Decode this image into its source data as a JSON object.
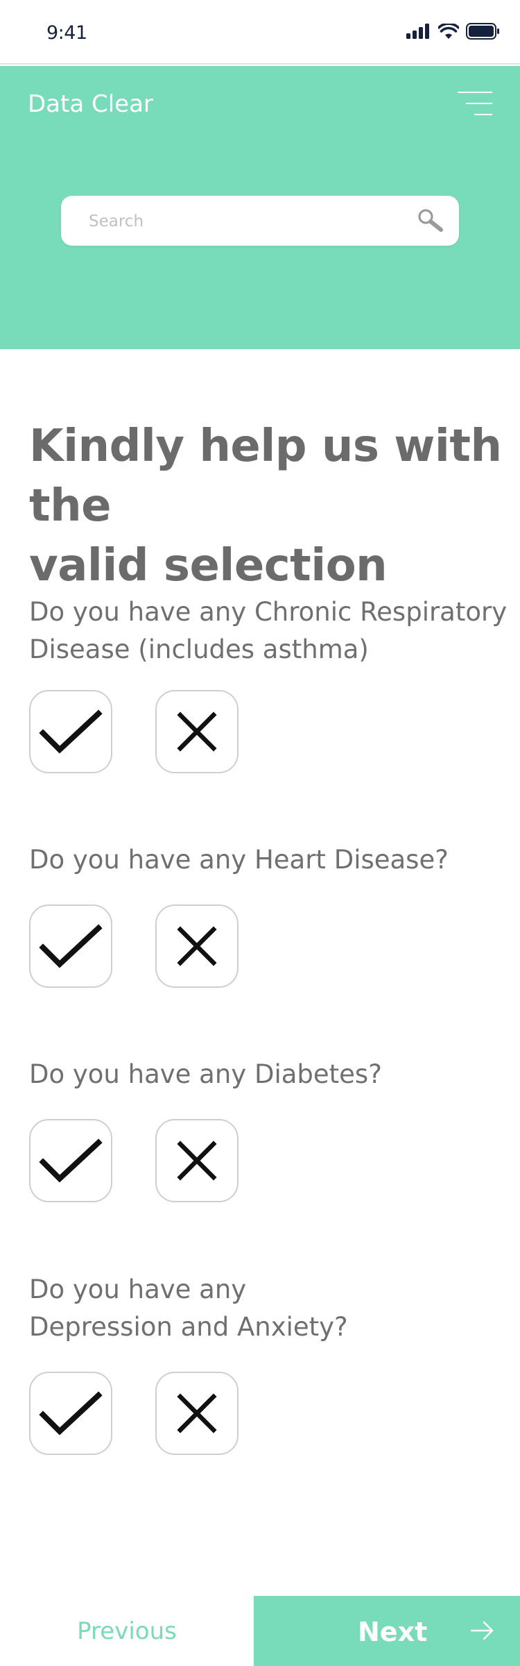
{
  "status_bar": {
    "time": "9:41"
  },
  "header": {
    "app_title": "Data Clear",
    "background_color": "#78dbb9",
    "menu_icon": "hamburger-menu-icon"
  },
  "search": {
    "placeholder": "Search",
    "value": "",
    "icon": "search-icon"
  },
  "main": {
    "title": "Kindly help us with the\nvalid selection",
    "questions": [
      {
        "text": "Do you have any Chronic Respiratory\nDisease (includes asthma)"
      },
      {
        "text": "Do you have any Heart Disease?"
      },
      {
        "text": "Do you have any Diabetes?"
      },
      {
        "text": "Do you have any\nDepression and Anxiety?"
      }
    ],
    "answer_icons": {
      "yes": "checkmark-icon",
      "no": "cross-icon"
    }
  },
  "footer": {
    "previous_label": "Previous",
    "next_label": "Next",
    "accent_color": "#78dbb9"
  }
}
